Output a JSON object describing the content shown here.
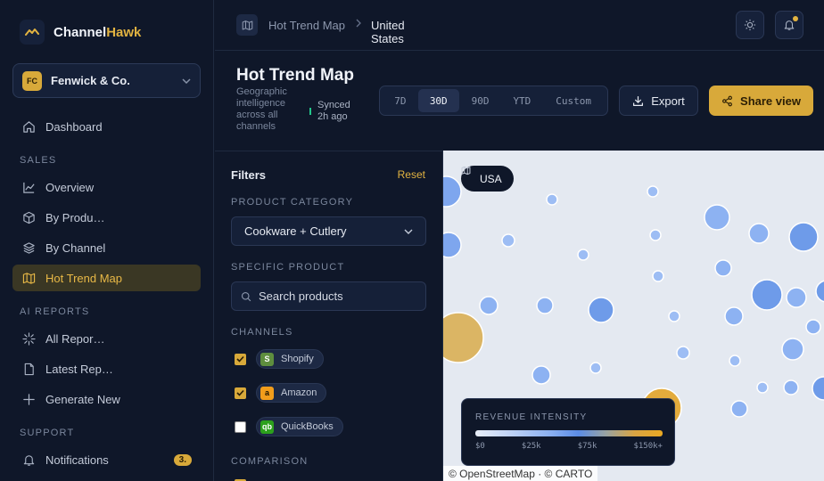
{
  "brand": {
    "name_main": "Channel",
    "name_accent": "Hawk"
  },
  "org": {
    "initials": "FC",
    "name": "Fenwick & Co."
  },
  "sidebar": {
    "items_top": [
      {
        "label": "Dashboard",
        "icon": "home-icon"
      }
    ],
    "sections": [
      {
        "label": "SALES",
        "items": [
          {
            "label": "Overview",
            "icon": "chart-line-icon"
          },
          {
            "label": "By Produ…",
            "icon": "cube-icon"
          },
          {
            "label": "By Channel",
            "icon": "layers-icon"
          },
          {
            "label": "Hot Trend Map",
            "icon": "map-icon",
            "active": true
          }
        ]
      },
      {
        "label": "AI REPORTS",
        "items": [
          {
            "label": "All Repor…",
            "icon": "sparkle-icon"
          },
          {
            "label": "Latest Rep…",
            "icon": "document-icon"
          },
          {
            "label": "Generate New",
            "icon": "plus-icon"
          }
        ]
      },
      {
        "label": "SUPPORT",
        "items": [
          {
            "label": "Notifications",
            "icon": "bell-icon",
            "badge": "3."
          }
        ]
      }
    ]
  },
  "breadcrumb": {
    "parent": "Hot Trend Map",
    "current": "United States"
  },
  "header": {
    "title": "Hot Trend Map",
    "subtitle": "Geographic intelligence across all channels",
    "sync_status": "Synced 2h ago",
    "ranges": [
      "7D",
      "30D",
      "90D",
      "YTD",
      "Custom"
    ],
    "active_range": "30D",
    "export_label": "Export",
    "share_label": "Share view"
  },
  "filters": {
    "title": "Filters",
    "reset_label": "Reset",
    "category_label": "PRODUCT CATEGORY",
    "category_value": "Cookware + Cutlery",
    "product_label": "SPECIFIC PRODUCT",
    "product_placeholder": "Search products",
    "channels_label": "CHANNELS",
    "channels": [
      {
        "name": "Shopify",
        "logo": "S",
        "checked": true,
        "color": "#5e8e3e"
      },
      {
        "name": "Amazon",
        "logo": "a",
        "checked": true,
        "color": "#f29d1b"
      },
      {
        "name": "QuickBooks",
        "logo": "qb",
        "checked": false,
        "color": "#2ca01c"
      }
    ],
    "comparison_label": "COMPARISON"
  },
  "map": {
    "region_chip": "USA",
    "legend_title": "REVENUE INTENSITY",
    "legend_ticks": [
      "$0",
      "$25k",
      "$75k",
      "$150k+"
    ],
    "attribution": "© OpenStreetMap · © CARTO",
    "colors": {
      "low": "#a9c4f4",
      "mid": "#6e9be9",
      "high": "#dbb564"
    }
  }
}
